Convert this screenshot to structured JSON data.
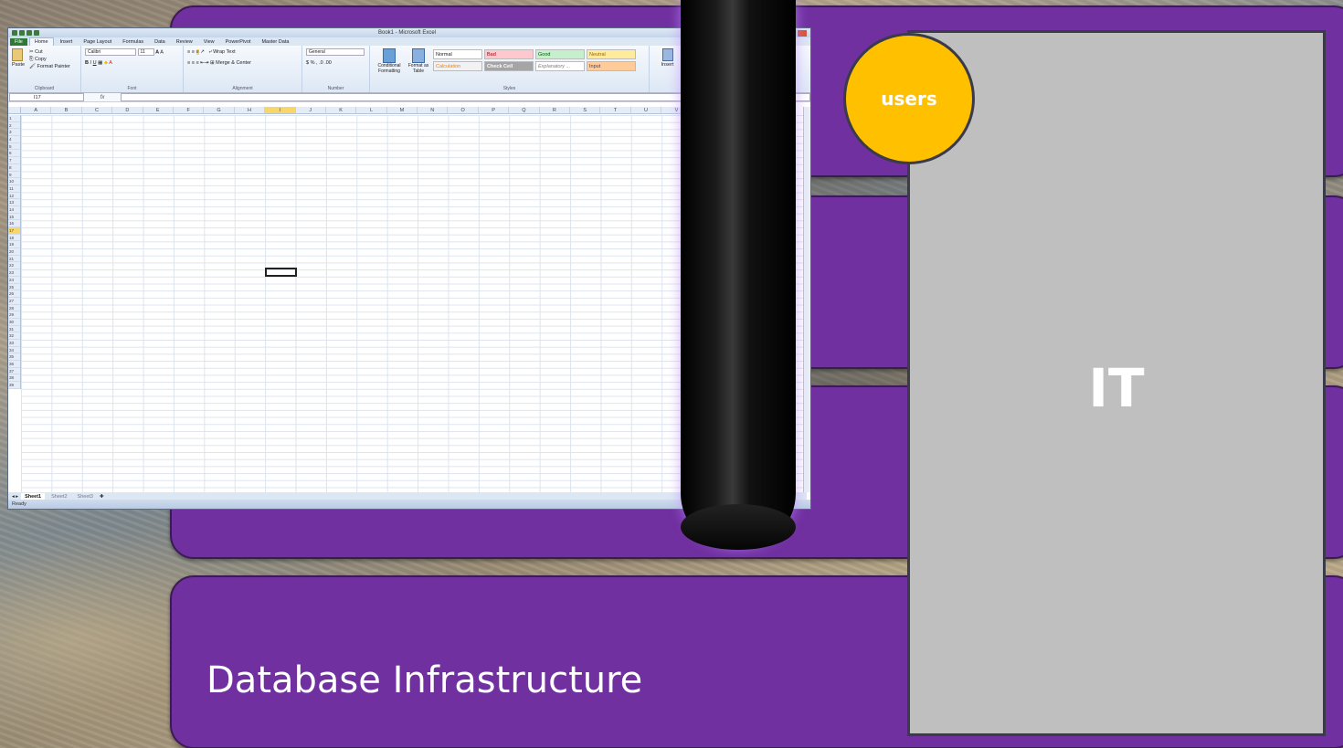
{
  "diagram": {
    "band_bottom_label": "Database Infrastructure",
    "it_box_label": "IT",
    "users_label": "users",
    "colors": {
      "band": "#7030a0",
      "it_box": "#bfbfbf",
      "users": "#ffc000"
    }
  },
  "excel": {
    "title": "Book1 - Microsoft Excel",
    "tabs": [
      "File",
      "Home",
      "Insert",
      "Page Layout",
      "Formulas",
      "Data",
      "Review",
      "View",
      "PowerPivot",
      "Master Data"
    ],
    "clipboard": {
      "paste": "Paste",
      "cut": "Cut",
      "copy": "Copy",
      "format_painter": "Format Painter",
      "group": "Clipboard"
    },
    "font": {
      "name": "Calibri",
      "size": "11",
      "group": "Font"
    },
    "alignment": {
      "wrap": "Wrap Text",
      "merge": "Merge & Center",
      "group": "Alignment"
    },
    "number": {
      "format": "General",
      "group": "Number"
    },
    "styles": {
      "conditional": "Conditional Formatting",
      "format_table": "Format as Table",
      "cells": [
        "Normal",
        "Bad",
        "Good",
        "Neutral",
        "Calculation",
        "Check Cell",
        "Explanatory ...",
        "Input"
      ],
      "group": "Styles"
    },
    "insert": "Insert",
    "namebox": "I17",
    "fx": "fx",
    "columns": [
      "A",
      "B",
      "C",
      "D",
      "E",
      "F",
      "G",
      "H",
      "I",
      "J",
      "K",
      "L",
      "M",
      "N",
      "O",
      "P",
      "Q",
      "R",
      "S",
      "T",
      "U",
      "V"
    ],
    "selected_column": "I",
    "rows": [
      "1",
      "2",
      "3",
      "4",
      "5",
      "6",
      "7",
      "8",
      "9",
      "10",
      "11",
      "12",
      "13",
      "14",
      "15",
      "16",
      "17",
      "18",
      "19",
      "20",
      "21",
      "22",
      "23",
      "24",
      "25",
      "26",
      "27",
      "28",
      "29",
      "30",
      "31",
      "32",
      "33",
      "34",
      "35",
      "36",
      "37",
      "38",
      "39"
    ],
    "selected_row": "17",
    "sheets": [
      "Sheet1",
      "Sheet2",
      "Sheet3"
    ],
    "status": "Ready"
  }
}
